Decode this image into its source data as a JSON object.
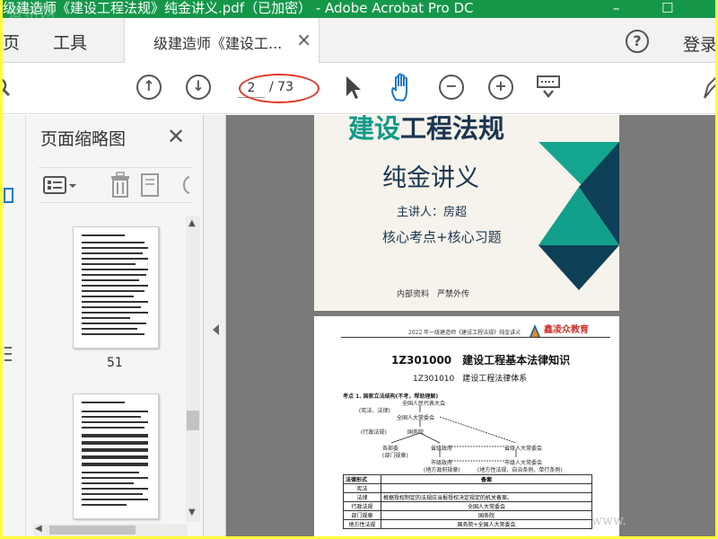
{
  "window": {
    "title": "级建造师《建设工程法规》纯金讲义.pdf（已加密） - Adobe Acrobat Pro DC",
    "watermark": "道格网",
    "minimize": "–",
    "restore": "☐"
  },
  "menubar": {
    "home": "页",
    "tools": "工具",
    "doc_tab": "级建造师《建设工...",
    "help": "?",
    "login": "登录"
  },
  "toolbar": {
    "current_page": "2",
    "total_pages": "/ 73"
  },
  "sidebar": {
    "title": "页面缩略图",
    "thumb_page_number": "51"
  },
  "page1": {
    "title_a": "建设",
    "title_b": "工程法规",
    "subtitle": "纯金讲义",
    "speaker": "主讲人：房超",
    "core": "核心考点+核心习题",
    "internal": "内部资料　严禁外传"
  },
  "page2": {
    "header": "2022 年一级建造师《建设工程法规》纯金讲义",
    "logo": "鑫凌众教育",
    "h1": "1Z301000　建设工程基本法律知识",
    "h2": "1Z301010　建设工程法律体系",
    "point": "考点 1. 国家立法结构(不考，帮助理解)",
    "npc": "全国人民代表大会",
    "constitution": "(宪法、法律)",
    "npc_standing": "全国人大常委会",
    "admin_regs": "(行政法规)",
    "state_council": "国务院",
    "ministries": "各部委",
    "dept_rules": "(部门规章)",
    "prov_gov": "省级政府",
    "prov_npc": "省级人大常委会",
    "city_gov": "市级政府",
    "city_npc": "市级人大常委会",
    "local_gov_rules": "(地方政府规章)",
    "local_laws": "(地方性法规、自治条例、单行条例)",
    "table_header": [
      "法律形式",
      "备案"
    ],
    "table_rows": [
      [
        "宪法",
        ""
      ],
      [
        "法律",
        "根据授权制定的法规应当报授权决定规定的机关备案。"
      ],
      [
        "行政法规",
        "全国人大常委会"
      ],
      [
        "部门规章",
        "国务院"
      ],
      [
        "地方性法规",
        "国务院+全国人大常委会"
      ]
    ]
  },
  "watermark_bottom": "www."
}
